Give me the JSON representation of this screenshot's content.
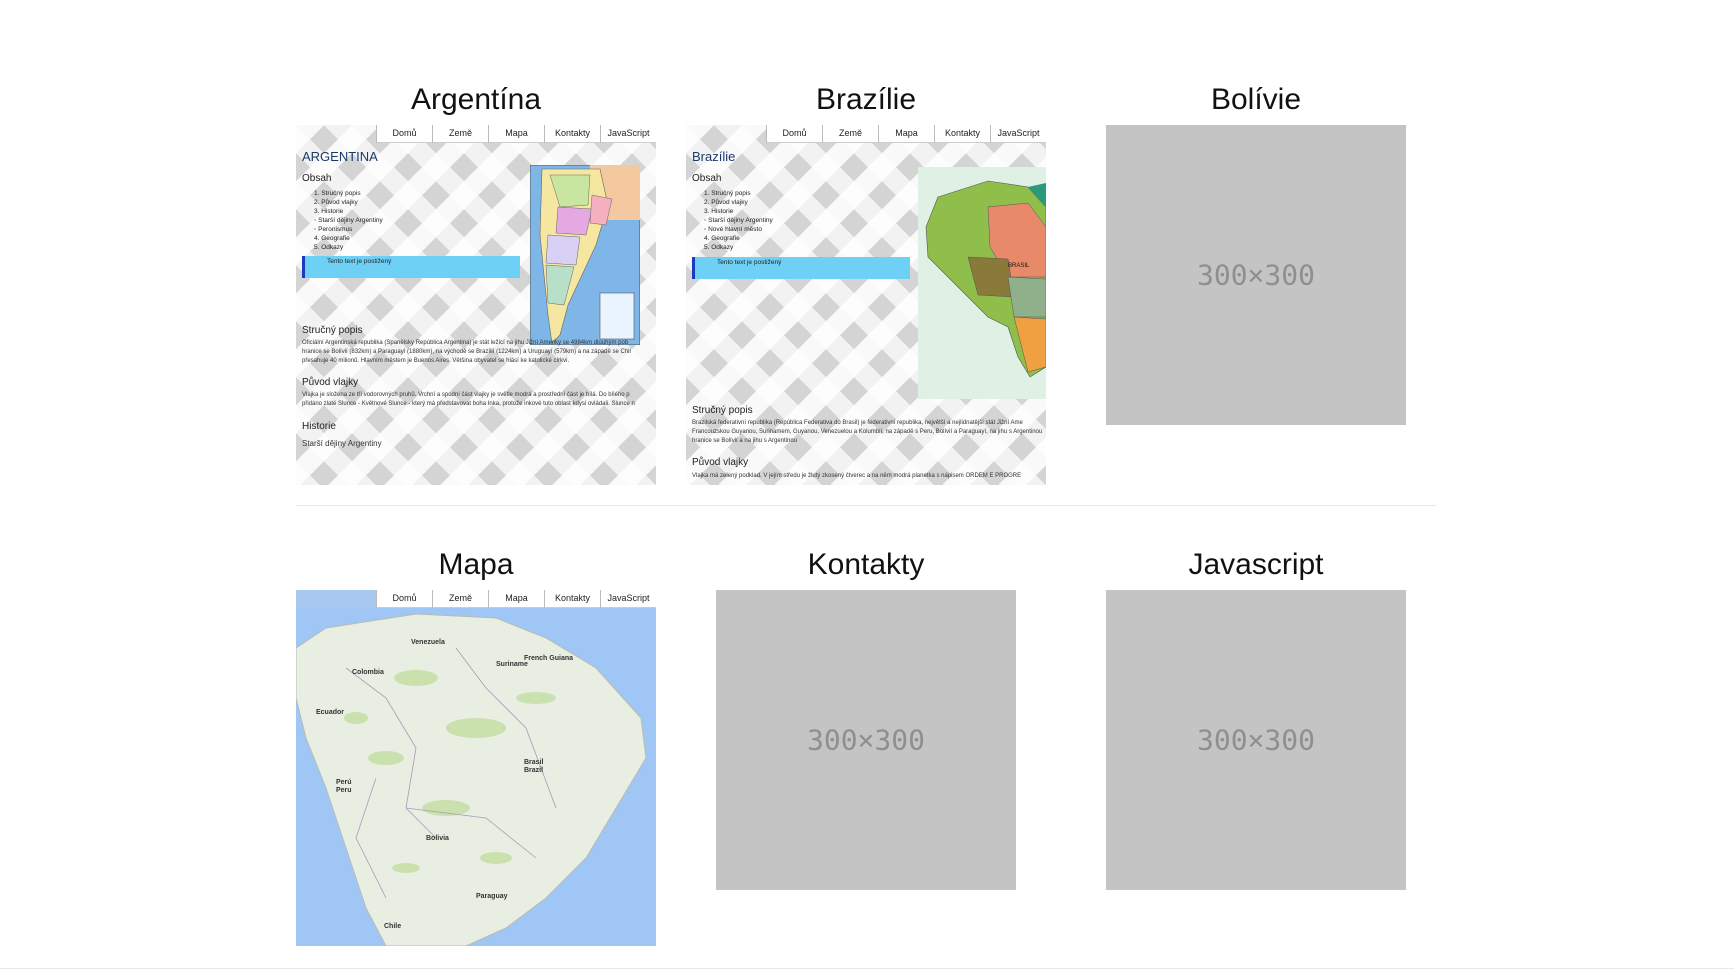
{
  "cards": [
    {
      "title": "Argentína"
    },
    {
      "title": "Brazílie"
    },
    {
      "title": "Bolívie",
      "placeholder": "300×300"
    },
    {
      "title": "Mapa"
    },
    {
      "title": "Kontakty",
      "placeholder": "300×300"
    },
    {
      "title": "Javascript",
      "placeholder": "300×300"
    }
  ],
  "mini_nav": [
    "Domů",
    "Země",
    "Mapa",
    "Kontakty",
    "JavaScript"
  ],
  "argentina_site": {
    "heading": "ARGENTINA",
    "toc_title": "Obsah",
    "toc": [
      "1. Stručný popis",
      "2. Původ vlajky",
      "3. Historie",
      "◦ Starší dějiny Argentiny",
      "◦ Peronismus",
      "4. Geografie",
      "5. Odkazy"
    ],
    "note": "Tento text je postižený",
    "sec1": "Stručný popis",
    "para1a": "Oficiální Argentinská republika (Španělsky República Argentina) je stát ležící na jihu Jižní Ameriky se 4984km dlouhým pob",
    "para1b": "hranice se Bolívií (832km) a Paraguayí (1880km), na východě se Brazílií (1224km) a Uruguayí (579km) a na západě se Chil",
    "para1c": "přesahuje 40 milionů. Hlavním městem je Buenos Aires. Většina obyvatel se hlásí ke katolické církvi.",
    "sec2": "Původ vlajky",
    "para2a": "Vlajka je složena ze tří vodorovných pruhů. Vrchní a spodní část vlajky je světle modrá a prostřední část je bílá. Do bílého p",
    "para2b": "přidáno zlaté Slunce - Květnové Slunce - který má představovat boha Inka, protože inkové tuto oblast kdysi ovládali. Slunce n",
    "sec3": "Historie",
    "sub3": "Starší dějiny Argentiny"
  },
  "brazil_site": {
    "heading": "Brazílie",
    "toc_title": "Obsah",
    "toc": [
      "1. Stručný popis",
      "2. Původ vlajky",
      "3. Historie",
      "◦ Starší dějiny Argentiny",
      "◦ Nové hlavní město",
      "4. Geografie",
      "5. Odkazy"
    ],
    "note": "Tento text je postižený",
    "map_label": "BRASIL",
    "sec1": "Stručný popis",
    "para1a": "Brazilská federativní republika (República Federativa do Brasil) je federativní republika, největší a nejlidnatější stát Jižní Ame",
    "para1b": "Francouzskou Guyanou, Surinamem, Guyanou, Venezuelou a Kolumbií, na západě s Peru, Bolívií a Paraguayí, na jihu s Argentinou",
    "para1c": "hranice se Bolívií a na jihu s Argentinou",
    "sec2": "Původ vlajky",
    "para2a": "Vlajka má zelený podklad. V jejím středu je žlutý zkosený čtverec a na něm modrá planetka s nápisem ORDEM E PROGRE"
  },
  "map_site": {
    "labels": [
      "Venezuela",
      "Colombia",
      "Suriname",
      "French Guiana",
      "Ecuador",
      "Brasil",
      "Brazil",
      "Perú",
      "Peru",
      "Bolivia",
      "Paraguay",
      "Chile"
    ]
  }
}
